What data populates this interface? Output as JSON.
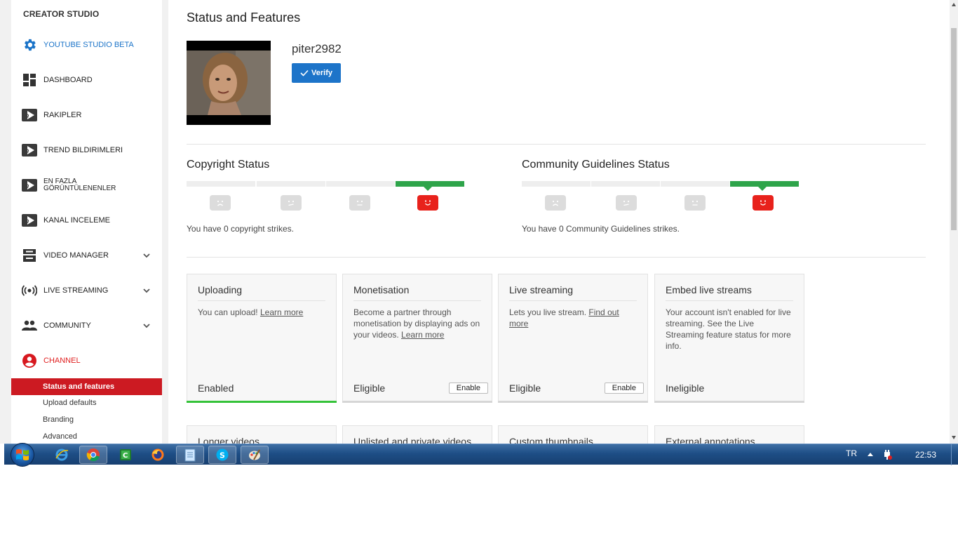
{
  "sidebar": {
    "header": "CREATOR STUDIO",
    "items": [
      {
        "label": "YOUTUBE STUDIO BETA"
      },
      {
        "label": "DASHBOARD"
      },
      {
        "label": "RAKIPLER"
      },
      {
        "label": "TREND BILDIRIMLERI"
      },
      {
        "label": "EN FAZLA",
        "label2": "GÖRÜNTÜLENENLER"
      },
      {
        "label": "KANAL INCELEME"
      },
      {
        "label": "VIDEO MANAGER"
      },
      {
        "label": "LIVE STREAMING"
      },
      {
        "label": "COMMUNITY"
      },
      {
        "label": "CHANNEL"
      }
    ],
    "subitems": [
      {
        "label": "Status and features"
      },
      {
        "label": "Upload defaults"
      },
      {
        "label": "Branding"
      },
      {
        "label": "Advanced"
      }
    ]
  },
  "main": {
    "title": "Status and Features",
    "username": "piter2982",
    "verify_label": "Verify",
    "copyright": {
      "title": "Copyright Status",
      "text": "You have 0 copyright strikes."
    },
    "community": {
      "title": "Community Guidelines Status",
      "text": "You have 0 Community Guidelines strikes."
    },
    "cards": [
      {
        "title": "Uploading",
        "desc": "You can upload! ",
        "link": "Learn more",
        "state": "Enabled"
      },
      {
        "title": "Monetisation",
        "desc": "Become a partner through monetisation by displaying ads on your videos. ",
        "link": "Learn more",
        "state": "Eligible",
        "button": "Enable"
      },
      {
        "title": "Live streaming",
        "desc": "Lets you live stream. ",
        "link": "Find out more",
        "state": "Eligible",
        "button": "Enable"
      },
      {
        "title": "Embed live streams",
        "desc": "Your account isn't enabled for live streaming. See the Live Streaming feature status for more info.",
        "state": "Ineligible"
      }
    ],
    "cards_row2": [
      {
        "title": "Longer videos"
      },
      {
        "title": "Unlisted and private videos"
      },
      {
        "title": "Custom thumbnails"
      },
      {
        "title": "External annotations"
      }
    ]
  },
  "taskbar": {
    "language": "TR",
    "clock": "22:53"
  },
  "colors": {
    "accent_blue": "#1d74c9",
    "channel_red": "#cc1a22",
    "good_green": "#2ea44a",
    "enabled_green": "#35c339"
  }
}
